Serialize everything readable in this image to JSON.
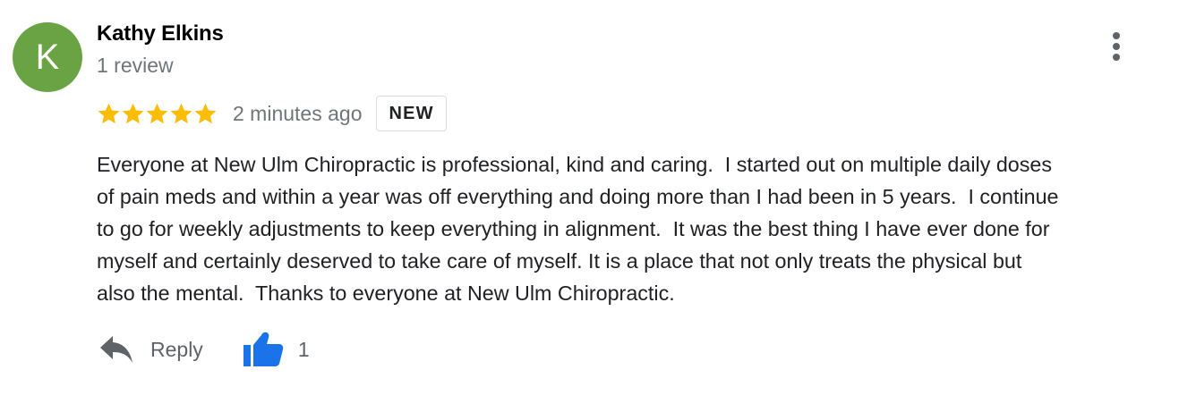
{
  "review": {
    "author": {
      "initial": "K",
      "name": "Kathy Elkins",
      "review_count": "1 review",
      "avatar_color": "#6aa343"
    },
    "rating": 5,
    "rating_max": 5,
    "star_color": "#fbbc04",
    "time": "2 minutes ago",
    "badge": "NEW",
    "text_lines": [
      "Everyone at New Ulm Chiropractic is professional, kind and caring.  I started out on multiple daily doses",
      "of pain meds and within a year was off everything and doing more than I had been in 5 years.  I continue",
      "to go for weekly adjustments to keep everything in alignment.  It was the best thing I have ever done for",
      "myself and certainly deserved to take care of myself. It is a place that not only treats the physical but",
      "also the mental.  Thanks to everyone at New Ulm Chiropractic."
    ],
    "actions": {
      "reply_label": "Reply",
      "reply_icon": "reply-arrow-icon",
      "like_icon": "thumbs-up-icon",
      "like_count": "1",
      "like_color": "#1a73e8"
    },
    "menu_icon": "more-vertical-icon"
  }
}
